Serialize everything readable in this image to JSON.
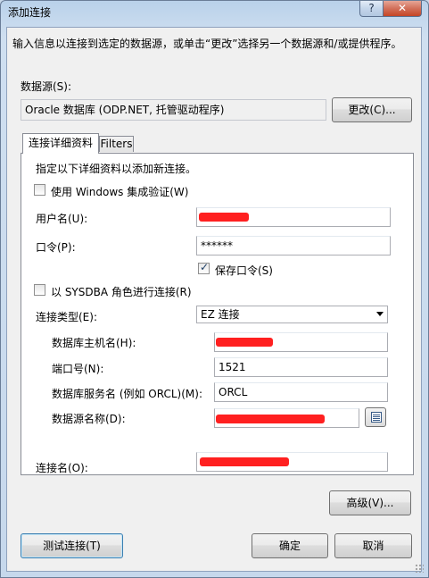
{
  "window": {
    "title": "添加连接",
    "help": "?",
    "close": "✕"
  },
  "intro": "输入信息以连接到选定的数据源，或单击“更改”选择另一个数据源和/或提供程序。",
  "datasource": {
    "label": "数据源(S):",
    "value": "Oracle 数据库 (ODP.NET, 托管驱动程序)",
    "change_button": "更改(C)..."
  },
  "tabs": [
    {
      "label": "连接详细资料",
      "active": true
    },
    {
      "label": "Filters",
      "active": false
    }
  ],
  "panel": {
    "instruction": "指定以下详细资料以添加新连接。",
    "windows_auth": {
      "label": "使用 Windows 集成验证(W)",
      "checked": false
    },
    "username": {
      "label": "用户名(U):"
    },
    "password": {
      "label": "口令(P):",
      "value": "******"
    },
    "save_password": {
      "label": "保存口令(S)",
      "checked": true
    },
    "sysdba": {
      "label": "以 SYSDBA 角色进行连接(R)",
      "checked": false
    },
    "connection_type": {
      "label": "连接类型(E):",
      "value": "EZ 连接"
    },
    "db_host": {
      "label": "数据库主机名(H):"
    },
    "port": {
      "label": "端口号(N):",
      "value": "1521"
    },
    "service_name": {
      "label": "数据库服务名 (例如 ORCL)(M):",
      "value": "ORCL"
    },
    "datasource_name": {
      "label": "数据源名称(D):"
    },
    "connection_name": {
      "label": "连接名(O):"
    }
  },
  "buttons": {
    "advanced": "高级(V)...",
    "test": "测试连接(T)",
    "ok": "确定",
    "cancel": "取消"
  },
  "colors": {
    "redaction": "#ff2020",
    "title_bg": "#b9d1ea",
    "close_btn": "#c54525"
  }
}
